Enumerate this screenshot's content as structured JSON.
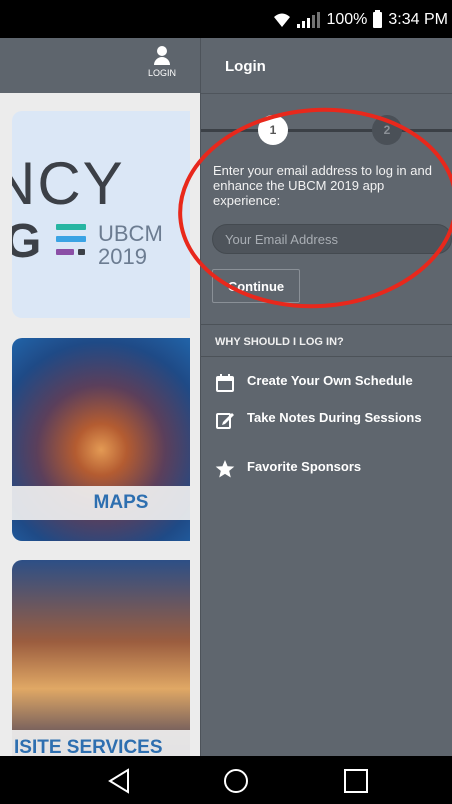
{
  "status_bar": {
    "battery": "100%",
    "time": "3:34 PM"
  },
  "background_app": {
    "login_label": "LOGIN",
    "hero": {
      "big_text": "NCY",
      "g_text": "G",
      "brand_line1": "UBCM",
      "brand_line2": "2019"
    },
    "tiles": [
      {
        "label": "MAPS"
      },
      {
        "label": "ISITE SERVICES"
      }
    ]
  },
  "drawer": {
    "title": "Login",
    "steps": [
      "1",
      "2"
    ],
    "intro": "Enter your email address to log in and enhance the UBCM 2019 app experience:",
    "email_placeholder": "Your Email Address",
    "continue_label": "Continue",
    "why_heading": "WHY SHOULD I LOG IN?",
    "benefits": [
      {
        "icon": "calendar-icon",
        "text": "Create Your Own Schedule"
      },
      {
        "icon": "edit-note-icon",
        "text": "Take Notes During Sessions"
      },
      {
        "icon": "star-icon",
        "text": "Favorite Sponsors"
      }
    ]
  },
  "colors": {
    "drawer_bg": "#5f666e",
    "annotation": "#e8281c",
    "tile_label": "#2e6fb0",
    "stripe_colors": [
      "#27b5a2",
      "#3aa3e4",
      "#8b4fa6"
    ]
  },
  "nav_icons": [
    "back-icon",
    "home-icon",
    "recents-icon"
  ]
}
